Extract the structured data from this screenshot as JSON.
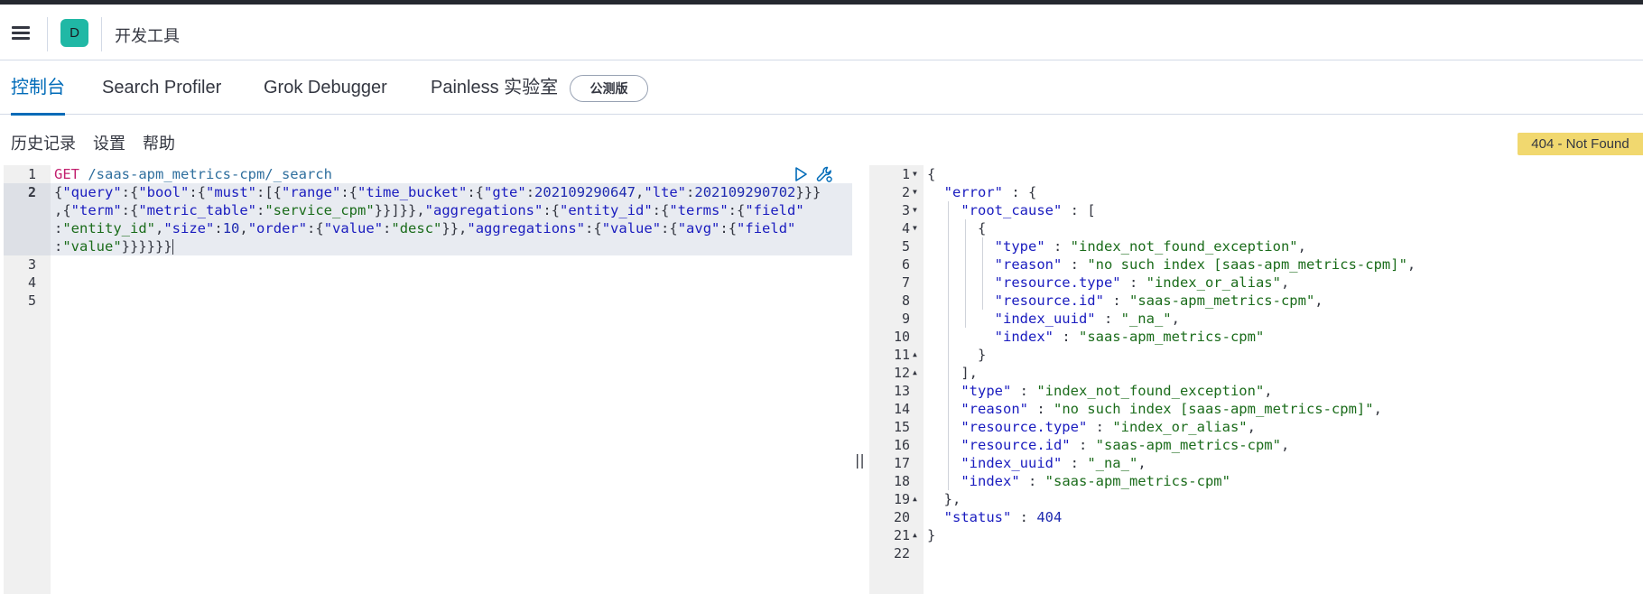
{
  "header": {
    "space_initial": "D",
    "app_title": "开发工具"
  },
  "tabs": [
    {
      "label": "控制台",
      "active": true
    },
    {
      "label": "Search Profiler",
      "active": false
    },
    {
      "label": "Grok Debugger",
      "active": false
    },
    {
      "label": "Painless 实验室",
      "active": false,
      "badge": "公测版"
    }
  ],
  "subnav": {
    "history": "历史记录",
    "settings": "设置",
    "help": "帮助"
  },
  "status_badge": "404 - Not Found",
  "colors": {
    "accent": "#006bb8",
    "status_warning": "#f1d86f",
    "space_badge": "#20b8a5",
    "string": "#1b6c1b",
    "method": "#c21f6e",
    "key": "#1a1cbf"
  },
  "request_editor": {
    "line_numbers": [
      "1",
      "2",
      "",
      "",
      "",
      "3",
      "4",
      "5"
    ],
    "lines": [
      "GET /saas-apm_metrics-cpm/_search",
      "{\"query\":{\"bool\":{\"must\":[{\"range\":{\"time_bucket\":{\"gte\":202109290647,\"lte\":202109290702}}}",
      ",{\"term\":{\"metric_table\":\"service_cpm\"}}]}},\"aggregations\":{\"entity_id\":{\"terms\":{\"field\"",
      ":\"entity_id\",\"size\":10,\"order\":{\"value\":\"desc\"}},\"aggregations\":{\"value\":{\"avg\":{\"field\"",
      ":\"value\"}}}}}}"
    ]
  },
  "response_editor": {
    "line_numbers": [
      "1",
      "2",
      "3",
      "4",
      "5",
      "6",
      "7",
      "8",
      "9",
      "10",
      "11",
      "12",
      "13",
      "14",
      "15",
      "16",
      "17",
      "18",
      "19",
      "20",
      "21",
      "22"
    ],
    "lines": [
      "{",
      "  \"error\" : {",
      "    \"root_cause\" : [",
      "      {",
      "        \"type\" : \"index_not_found_exception\",",
      "        \"reason\" : \"no such index [saas-apm_metrics-cpm]\",",
      "        \"resource.type\" : \"index_or_alias\",",
      "        \"resource.id\" : \"saas-apm_metrics-cpm\",",
      "        \"index_uuid\" : \"_na_\",",
      "        \"index\" : \"saas-apm_metrics-cpm\"",
      "      }",
      "    ],",
      "    \"type\" : \"index_not_found_exception\",",
      "    \"reason\" : \"no such index [saas-apm_metrics-cpm]\",",
      "    \"resource.type\" : \"index_or_alias\",",
      "    \"resource.id\" : \"saas-apm_metrics-cpm\",",
      "    \"index_uuid\" : \"_na_\",",
      "    \"index\" : \"saas-apm_metrics-cpm\"",
      "  },",
      "  \"status\" : 404",
      "}",
      ""
    ]
  },
  "icons": {
    "menu": "hamburger-icon",
    "run": "play-icon",
    "wrench": "wrench-icon",
    "resizer": "double-bar-icon"
  },
  "resizer_glyph": "||"
}
